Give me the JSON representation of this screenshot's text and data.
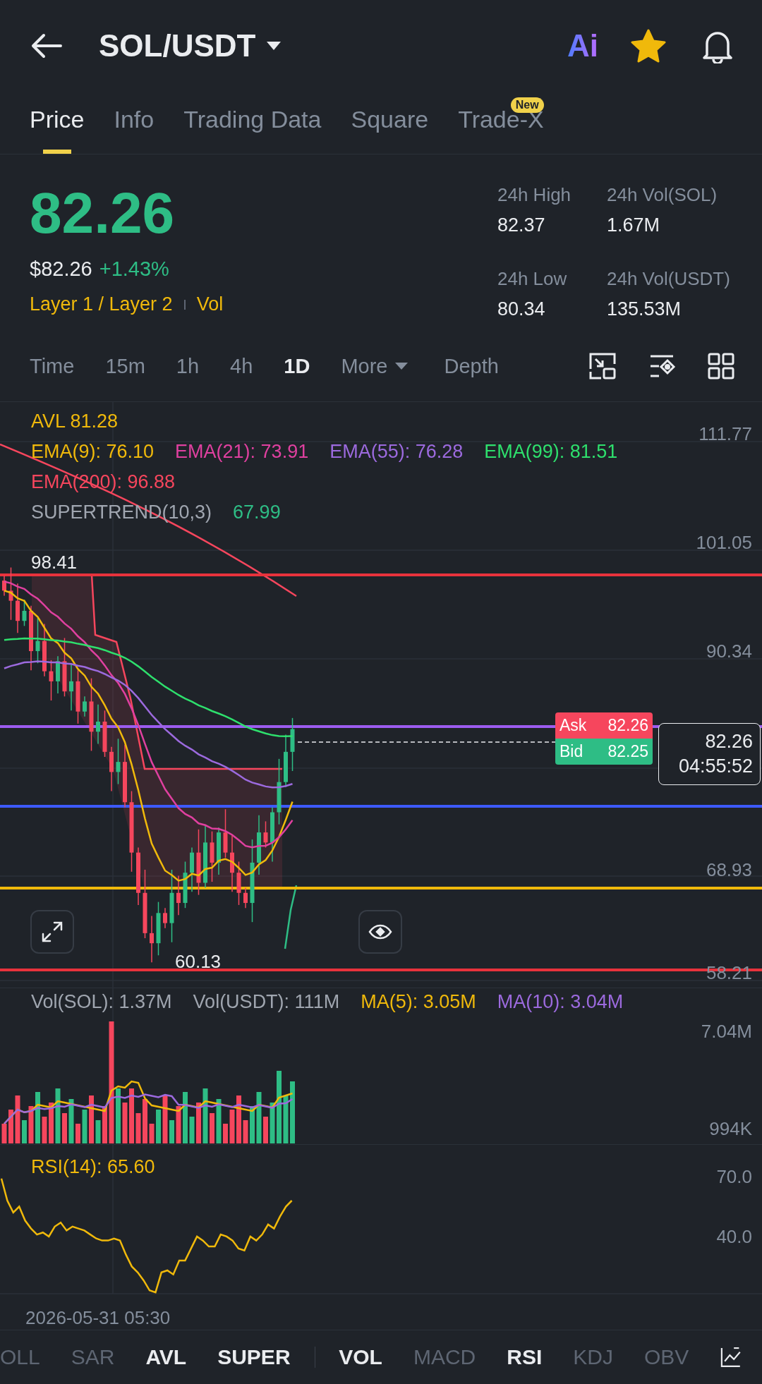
{
  "header": {
    "title": "SOL/USDT",
    "ai_label": "Ai",
    "favorite": true
  },
  "tabs": [
    {
      "label": "Price",
      "selected": true
    },
    {
      "label": "Info",
      "selected": false
    },
    {
      "label": "Trading Data",
      "selected": false
    },
    {
      "label": "Square",
      "selected": false
    },
    {
      "label": "Trade-X",
      "selected": false,
      "badge": "New"
    }
  ],
  "ticker": {
    "price": "82.26",
    "fiat": "$82.26",
    "change": "+1.43%",
    "tags": [
      "Layer 1 / Layer 2",
      "Vol"
    ],
    "stats": [
      {
        "label": "24h High",
        "value": "82.37"
      },
      {
        "label": "24h Vol(SOL)",
        "value": "1.67M"
      },
      {
        "label": "24h Low",
        "value": "80.34"
      },
      {
        "label": "24h Vol(USDT)",
        "value": "135.53M"
      }
    ]
  },
  "timeframes": [
    {
      "label": "Time",
      "selected": false,
      "kind": "plain"
    },
    {
      "label": "15m",
      "selected": false,
      "kind": "plain"
    },
    {
      "label": "1h",
      "selected": false,
      "kind": "plain"
    },
    {
      "label": "4h",
      "selected": false,
      "kind": "plain"
    },
    {
      "label": "1D",
      "selected": true,
      "kind": "plain"
    },
    {
      "label": "More",
      "selected": false,
      "kind": "dropdown"
    },
    {
      "label": "Depth",
      "selected": false,
      "kind": "plain"
    }
  ],
  "chart": {
    "legend": [
      [
        {
          "text": "AVL 81.28",
          "color": "#f0b90b"
        }
      ],
      [
        {
          "text": "EMA(9): 76.10",
          "color": "#f0b90b"
        },
        {
          "text": "EMA(21): 73.91",
          "color": "#e040a0"
        },
        {
          "text": "EMA(55): 76.28",
          "color": "#9c6ade"
        },
        {
          "text": "EMA(99): 81.51",
          "color": "#2ee06d"
        }
      ],
      [
        {
          "text": "EMA(200): 96.88",
          "color": "#f6465d"
        }
      ],
      [
        {
          "text": "SUPERTREND(10,3)",
          "color": "#a0a6b0"
        },
        {
          "text": "67.99",
          "color": "#2ebd85"
        }
      ]
    ],
    "y_axis": [
      "111.77",
      "101.05",
      "90.34",
      "68.93",
      "58.21"
    ],
    "high_marker": "98.41",
    "low_marker": "60.13",
    "ask": {
      "label": "Ask",
      "value": "82.26"
    },
    "bid": {
      "label": "Bid",
      "value": "82.25"
    },
    "last_price": "82.26",
    "countdown": "04:55:52"
  },
  "volume": {
    "legend": [
      {
        "text": "Vol(SOL): 1.37M",
        "color": "#a0a6b0"
      },
      {
        "text": "Vol(USDT): 111M",
        "color": "#a0a6b0"
      },
      {
        "text": "MA(5): 3.05M",
        "color": "#f0b90b"
      },
      {
        "text": "MA(10): 3.04M",
        "color": "#9c6ade"
      }
    ],
    "y_axis": [
      "7.04M",
      "994K"
    ]
  },
  "rsi": {
    "legend": "RSI(14): 65.60",
    "y_axis": [
      "70.0",
      "40.0"
    ],
    "date": "2026-05-31 05:30"
  },
  "main_indicators": [
    {
      "label": "OLL",
      "selected": false
    },
    {
      "label": "SAR",
      "selected": false
    },
    {
      "label": "AVL",
      "selected": true
    },
    {
      "label": "SUPER",
      "selected": true
    }
  ],
  "sub_indicators": [
    {
      "label": "VOL",
      "selected": true
    },
    {
      "label": "MACD",
      "selected": false
    },
    {
      "label": "RSI",
      "selected": true
    },
    {
      "label": "KDJ",
      "selected": false
    },
    {
      "label": "OBV",
      "selected": false
    }
  ]
}
